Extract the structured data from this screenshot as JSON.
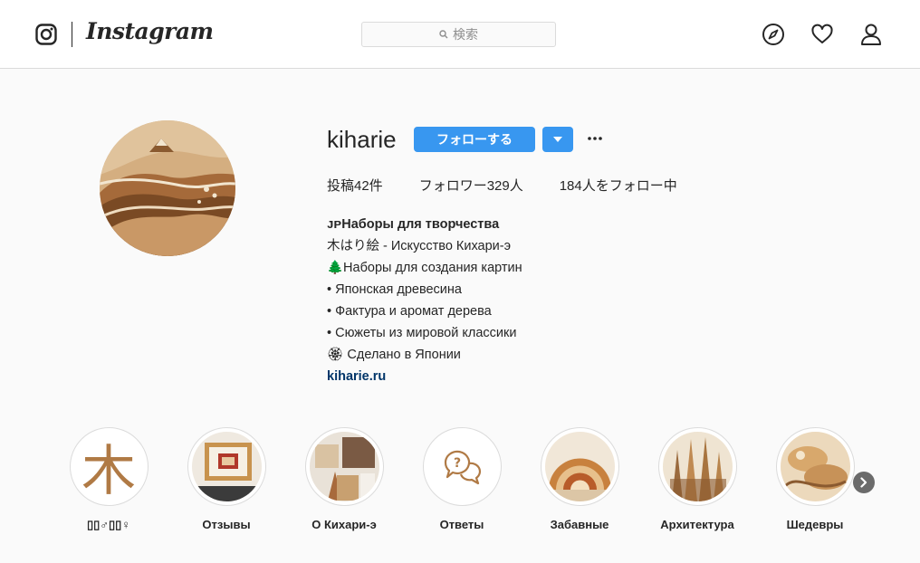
{
  "header": {
    "brand": "Instagram",
    "search_placeholder": "検索",
    "icons": [
      "instagram-logo-icon",
      "search-icon",
      "compass-icon",
      "heart-icon",
      "profile-icon"
    ]
  },
  "profile": {
    "username": "kiharie",
    "follow_label": "フォローする",
    "more_glyph": "•••",
    "stats": {
      "posts": "投稿42件",
      "followers": "フォロワー329人",
      "following": "184人をフォロー中"
    },
    "bio": {
      "title": "ᴊᴘНаборы для творчества",
      "lines": [
        "木はり絵 - Искусство Кихари-э",
        "🌲Наборы для создания картин",
        "• Японская древесина",
        "• Фактура и аромат дерева",
        "• Сюжеты из мировой классики",
        "🏵 Сделано в Японии"
      ],
      "link": "kiharie.ru"
    }
  },
  "highlights": [
    {
      "label": "▯▯♂▯▯♀",
      "icon": "kanji-wood-icon"
    },
    {
      "label": "Отзывы",
      "icon": "framed-picture-icon"
    },
    {
      "label": "О Кихари-э",
      "icon": "collage-icon"
    },
    {
      "label": "Ответы",
      "icon": "question-chat-icon"
    },
    {
      "label": "Забавные",
      "icon": "wood-pattern-icon"
    },
    {
      "label": "Архитектура",
      "icon": "cathedral-icon"
    },
    {
      "label": "Шедевры",
      "icon": "wood-artwork-icon"
    }
  ],
  "kanji": "木",
  "colors": {
    "accent": "#3897f0",
    "link": "#003569",
    "border": "#dbdbdb",
    "background": "#fafafa",
    "wood": "#b07a45"
  }
}
